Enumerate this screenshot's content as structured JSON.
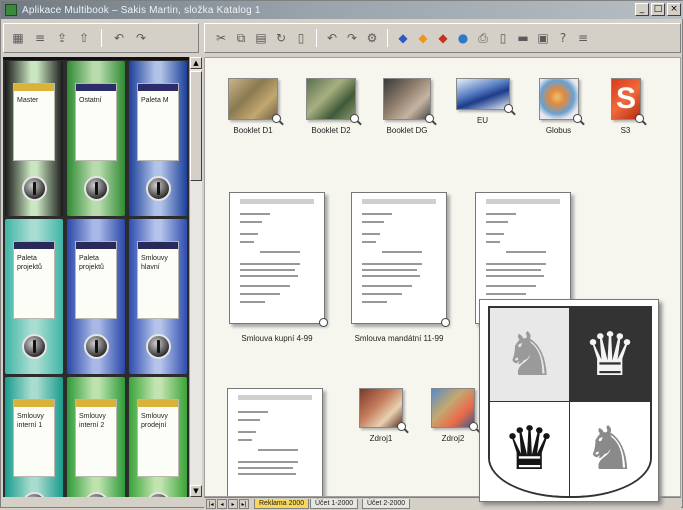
{
  "window": {
    "title": "Aplikace Multibook – Sakis Martin, složka Katalog 1",
    "controls": [
      "_",
      "□",
      "×"
    ]
  },
  "binders": [
    {
      "label": "Master",
      "color": "#1a1a1a"
    },
    {
      "label": "Ostatní",
      "color": "#2f8a32"
    },
    {
      "label": "Paleta M",
      "color": "#1c3f9a"
    },
    {
      "label": "Paleta projektů",
      "color": "#3fb5a5"
    },
    {
      "label": "Paleta projektů",
      "color": "#2a47a8"
    },
    {
      "label": "Smlouvy hlavní",
      "color": "#2e4db0"
    },
    {
      "label": "Smlouvy interní 1",
      "color": "#1a9c8d"
    },
    {
      "label": "Smlouvy interní 2",
      "color": "#2e9a3a"
    },
    {
      "label": "Smlouvy prodejní",
      "color": "#3aa338"
    }
  ],
  "thumbnails": [
    {
      "caption": "Booklet D1"
    },
    {
      "caption": "Booklet D2"
    },
    {
      "caption": "Booklet DG"
    },
    {
      "caption": "EU"
    },
    {
      "caption": "Globus"
    },
    {
      "caption": "S3"
    }
  ],
  "documents": [
    {
      "caption": "Smlouva kupní 4-99"
    },
    {
      "caption": "Smlouva mandátní 11-99"
    },
    {
      "caption": "Sm"
    }
  ],
  "photos": [
    {
      "caption": "Zdroj1"
    },
    {
      "caption": "Zdroj2"
    }
  ],
  "tabs": [
    "Reklama 2000",
    "Účet 1-2000",
    "Účet 2-2000"
  ],
  "nav_arrows": [
    "|◂",
    "◂",
    "▸",
    "▸|"
  ]
}
